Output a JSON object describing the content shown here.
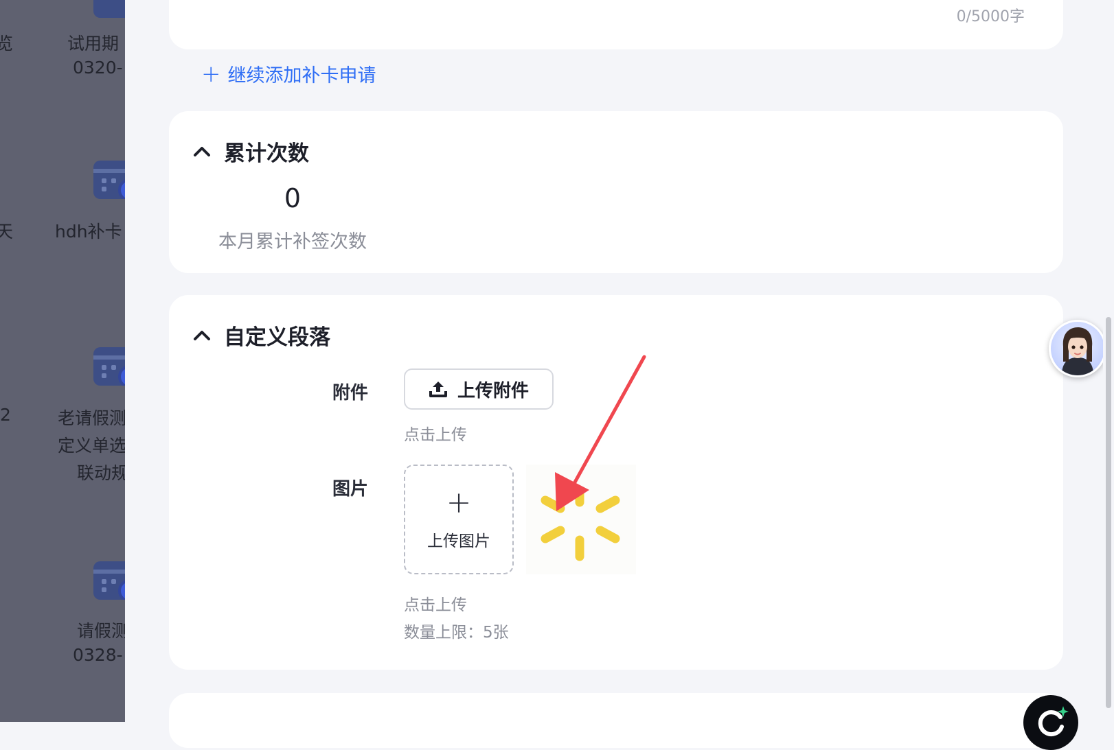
{
  "background_list": {
    "row1": {
      "left_fragment": "览",
      "title": "试用期",
      "subtitle": "0320-"
    },
    "row2": {
      "left_fragment": "天",
      "title": "hdh补卡"
    },
    "row3": {
      "left_fragment": "2",
      "title_lines": [
        "老请假测",
        "定义单选",
        "联动规"
      ]
    },
    "row4": {
      "title": "请假测",
      "subtitle": "0328-"
    }
  },
  "remark": {
    "counter": "0/5000字"
  },
  "add_more": {
    "label": "继续添加补卡申请"
  },
  "cumulative": {
    "title": "累计次数",
    "value": "0",
    "caption": "本月累计补签次数"
  },
  "custom_section": {
    "title": "自定义段落",
    "attachment": {
      "label": "附件",
      "button_label": "上传附件",
      "hint": "点击上传"
    },
    "image": {
      "label": "图片",
      "upload_label": "上传图片",
      "hint": "点击上传",
      "limit": "数量上限：5张"
    }
  },
  "colors": {
    "accent": "#2f6ef5",
    "annotation_arrow": "#f0474f",
    "thumbnail_spark": "#f2cf3c"
  },
  "icons": [
    "chevron-up-icon",
    "plus-icon",
    "upload-icon",
    "assistant-avatar",
    "ai-assistant-icon"
  ]
}
